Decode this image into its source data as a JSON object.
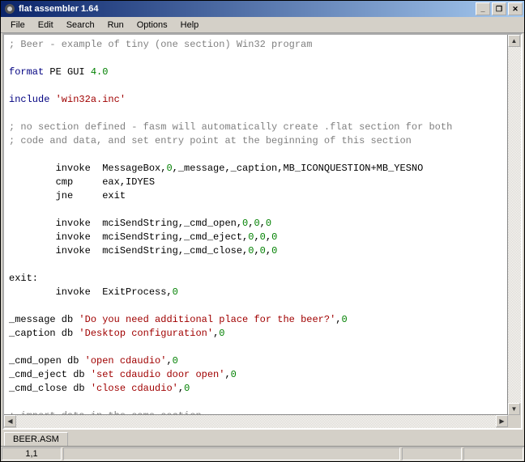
{
  "title": "flat assembler 1.64",
  "menu": {
    "file": "File",
    "edit": "Edit",
    "search": "Search",
    "run": "Run",
    "options": "Options",
    "help": "Help"
  },
  "controls": {
    "min": "_",
    "max": "❐",
    "close": "✕"
  },
  "tab": "BEER.ASM",
  "status": {
    "pos": "1,1"
  },
  "code": {
    "c1": "; Beer - example of tiny (one section) Win32 program",
    "l2a": "format",
    "l2b": " PE GUI ",
    "l2c": "4.0",
    "l3a": "include ",
    "l3b": "'win32a.inc'",
    "c4": "; no section defined - fasm will automatically create .flat section for both",
    "c5": "; code and data, and set entry point at the beginning of this section",
    "l6a": "        invoke  MessageBox,",
    "l6b": "0",
    "l6c": ",_message,_caption,MB_ICONQUESTION+MB_YESNO",
    "l7": "        cmp     eax,IDYES",
    "l8": "        jne     exit",
    "l9a": "        invoke  mciSendString,_cmd_open,",
    "l9b": "0",
    "l9c": ",",
    "l9d": "0",
    "l9e": ",",
    "l9f": "0",
    "l10a": "        invoke  mciSendString,_cmd_eject,",
    "l10b": "0",
    "l10c": ",",
    "l10d": "0",
    "l10e": ",",
    "l10f": "0",
    "l11a": "        invoke  mciSendString,_cmd_close,",
    "l11b": "0",
    "l11c": ",",
    "l11d": "0",
    "l11e": ",",
    "l11f": "0",
    "l12": "exit:",
    "l13a": "        invoke  ExitProcess,",
    "l13b": "0",
    "l14a": "_message db ",
    "l14b": "'Do you need additional place for the beer?'",
    "l14c": ",",
    "l14d": "0",
    "l15a": "_caption db ",
    "l15b": "'Desktop configuration'",
    "l15c": ",",
    "l15d": "0",
    "l16a": "_cmd_open db ",
    "l16b": "'open cdaudio'",
    "l16c": ",",
    "l16d": "0",
    "l17a": "_cmd_eject db ",
    "l17b": "'set cdaudio door open'",
    "l17c": ",",
    "l17d": "0",
    "l18a": "_cmd_close db ",
    "l18b": "'close cdaudio'",
    "l18c": ",",
    "l18d": "0",
    "c19": "; import data in the same section"
  }
}
